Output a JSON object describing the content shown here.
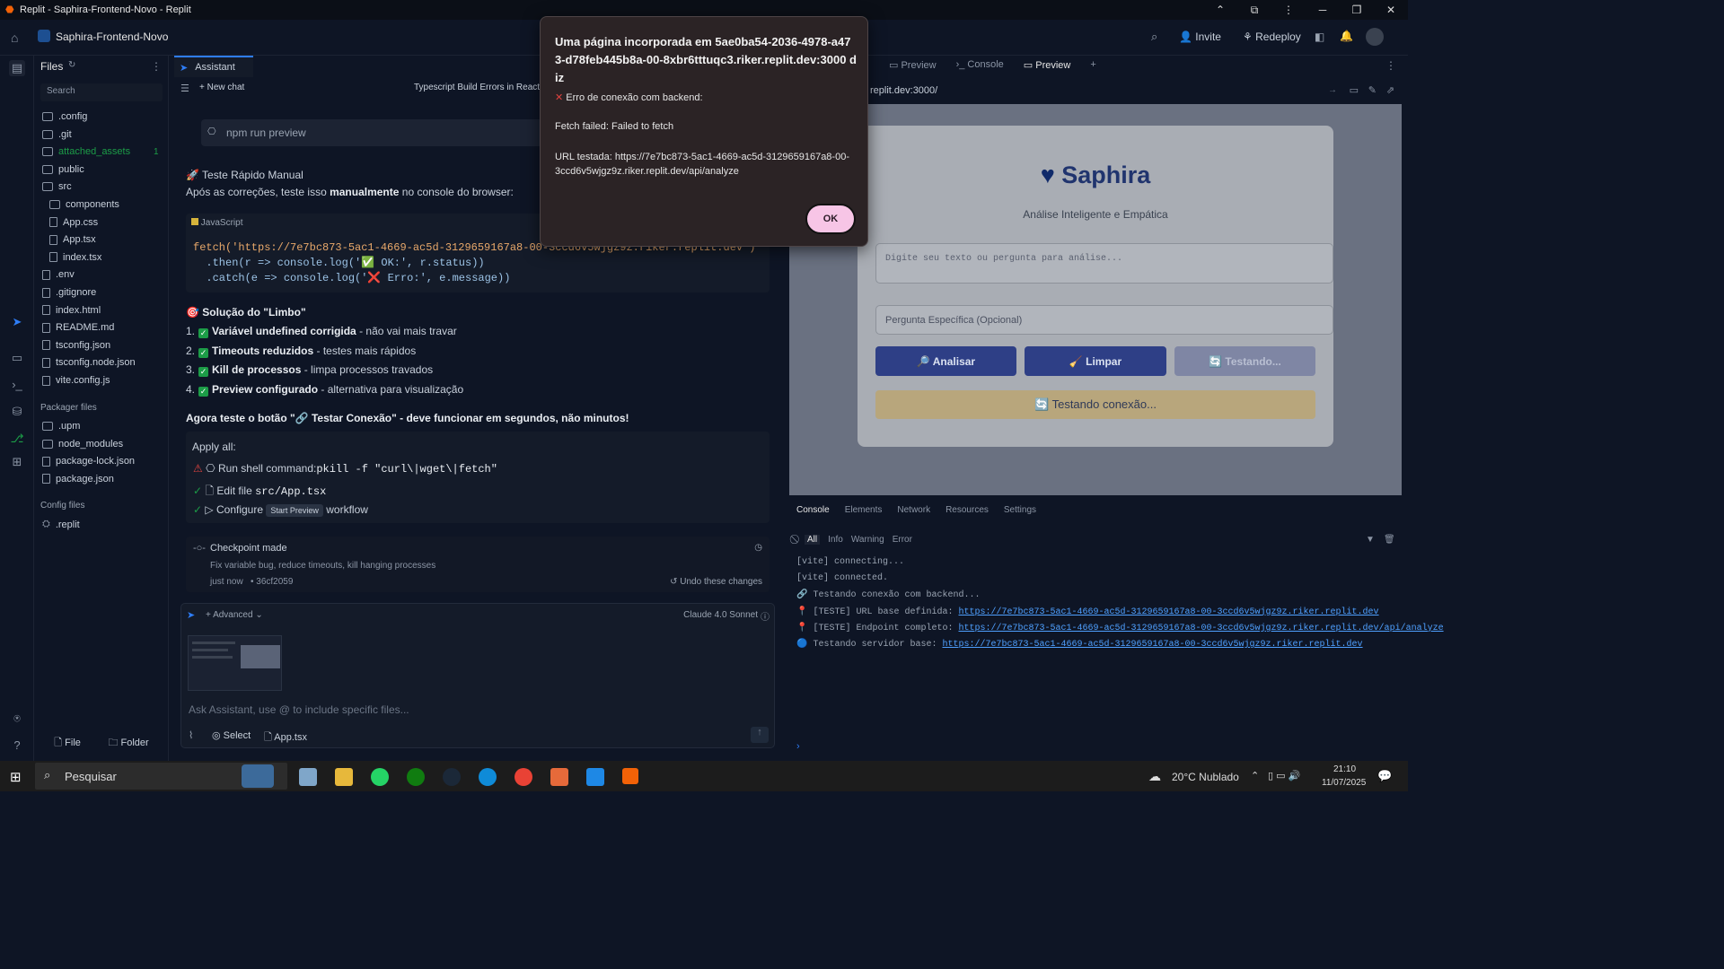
{
  "window": {
    "title": "Replit - Saphira-Frontend-Novo - Replit"
  },
  "topbar": {
    "project": "Saphira-Frontend-Novo",
    "invite": "Invite",
    "redeploy": "Redeploy"
  },
  "files": {
    "header": "Files",
    "search_placeholder": "Search",
    "items": [
      ".config",
      ".git",
      "attached_assets",
      "public",
      "src",
      "components",
      "App.css",
      "App.tsx",
      "index.tsx",
      ".env",
      ".gitignore",
      "index.html",
      "README.md",
      "tsconfig.json",
      "tsconfig.node.json",
      "vite.config.js"
    ],
    "attached_badge": "1",
    "packager_title": "Packager files",
    "packager_items": [
      ".upm",
      "node_modules",
      "package-lock.json",
      "package.json"
    ],
    "config_title": "Config files",
    "config_items": [
      ".replit"
    ],
    "file_btn": "File",
    "folder_btn": "Folder"
  },
  "assistant": {
    "tab": "Assistant",
    "new_chat": "New chat",
    "chat_title": "Typescript Build Errors in React",
    "npm_cmd": "npm run preview",
    "manual_title": "🚀 Teste Rápido Manual",
    "manual_text_pre": "Após as correções, teste isso ",
    "manual_text_bold": "manualmente",
    "manual_text_post": " no console do browser:",
    "code_lang": "JavaScript",
    "code_line1": "fetch('https://7e7bc873-5ac1-4669-ac5d-3129659167a8-00-3ccd6v5wjgz9z.riker.replit.dev')",
    "code_line2": "  .then(r => console.log('✅ OK:', r.status))",
    "code_line3": "  .catch(e => console.log('❌ Erro:', e.message))",
    "limbo_title": "🎯 Solução do \"Limbo\"",
    "list": [
      {
        "n": "1.",
        "bold": "Variável undefined corrigida",
        "rest": " - não vai mais travar"
      },
      {
        "n": "2.",
        "bold": "Timeouts reduzidos",
        "rest": " - testes mais rápidos"
      },
      {
        "n": "3.",
        "bold": "Kill de processos",
        "rest": " - limpa processos travados"
      },
      {
        "n": "4.",
        "bold": "Preview configurado",
        "rest": " - alternativa para visualização"
      }
    ],
    "now_test_pre": "Agora teste o botão \"",
    "now_test_btn": "🔗 Testar Conexão",
    "now_test_mid": "\" - deve funcionar em ",
    "now_test_bold": "segundos",
    "now_test_post": ", não minutos!",
    "apply_all": "Apply all:",
    "apply1_label": "Run shell command:",
    "apply1_code": "pkill -f \"curl\\|wget\\|fetch\"",
    "apply2_label": "Edit file",
    "apply2_code": "src/App.tsx",
    "apply3_label": "Configure",
    "apply3_tag": "Start Preview",
    "apply3_post": "workflow",
    "checkpoint_title": "Checkpoint made",
    "checkpoint_desc": "Fix variable bug, reduce timeouts, kill hanging processes",
    "checkpoint_time": "just now",
    "checkpoint_hash": "• 36cf2059",
    "undo": "Undo these changes",
    "advanced": "Advanced",
    "model": "Claude 4.0 Sonnet",
    "input_placeholder": "Ask Assistant, use @ to include specific files...",
    "select": "Select",
    "attach_file": "App.tsx"
  },
  "right": {
    "tabs": [
      "Preview",
      "Console",
      "Preview"
    ],
    "url": "replit.dev:3000/",
    "app": {
      "title": "Saphira",
      "subtitle": "Análise Inteligente e Empática",
      "textarea_placeholder": "Digite seu texto ou pergunta para análise...",
      "input_placeholder": "Pergunta Específica (Opcional)",
      "btn_analyze": "🔎 Analisar",
      "btn_clear": "🧹 Limpar",
      "btn_testing": "🔄 Testando...",
      "status": "🔄 Testando conexão..."
    },
    "devtools_tabs": [
      "Console",
      "Elements",
      "Network",
      "Resources",
      "Settings"
    ],
    "filters": [
      "All",
      "Info",
      "Warning",
      "Error"
    ],
    "logs": [
      {
        "text": "[vite] connecting...",
        "link": ""
      },
      {
        "text": "[vite] connected.",
        "link": ""
      },
      {
        "text": "🔗 Testando conexão com backend...",
        "link": ""
      },
      {
        "text": "📍 [TESTE] URL base definida: ",
        "link": "https://7e7bc873-5ac1-4669-ac5d-3129659167a8-00-3ccd6v5wjgz9z.riker.replit.dev"
      },
      {
        "text": "📍 [TESTE] Endpoint completo: ",
        "link": "https://7e7bc873-5ac1-4669-ac5d-3129659167a8-00-3ccd6v5wjgz9z.riker.replit.dev/api/analyze"
      },
      {
        "text": "🔵 Testando servidor base: ",
        "link": "https://7e7bc873-5ac1-4669-ac5d-3129659167a8-00-3ccd6v5wjgz9z.riker.replit.dev"
      }
    ]
  },
  "dialog": {
    "title": "Uma página incorporada em 5ae0ba54-2036-4978-a473-d78feb445b8a-00-8xbr6tttuqc3.riker.replit.dev:3000 diz",
    "error_line": "Erro de conexão com backend:",
    "fetch_line": "Fetch failed: Failed to fetch",
    "url_line": "URL testada: https://7e7bc873-5ac1-4669-ac5d-3129659167a8-00-3ccd6v5wjgz9z.riker.replit.dev/api/analyze",
    "ok": "OK"
  },
  "taskbar": {
    "search": "Pesquisar",
    "weather": "20°C  Nublado",
    "time": "21:10",
    "date": "11/07/2025"
  }
}
